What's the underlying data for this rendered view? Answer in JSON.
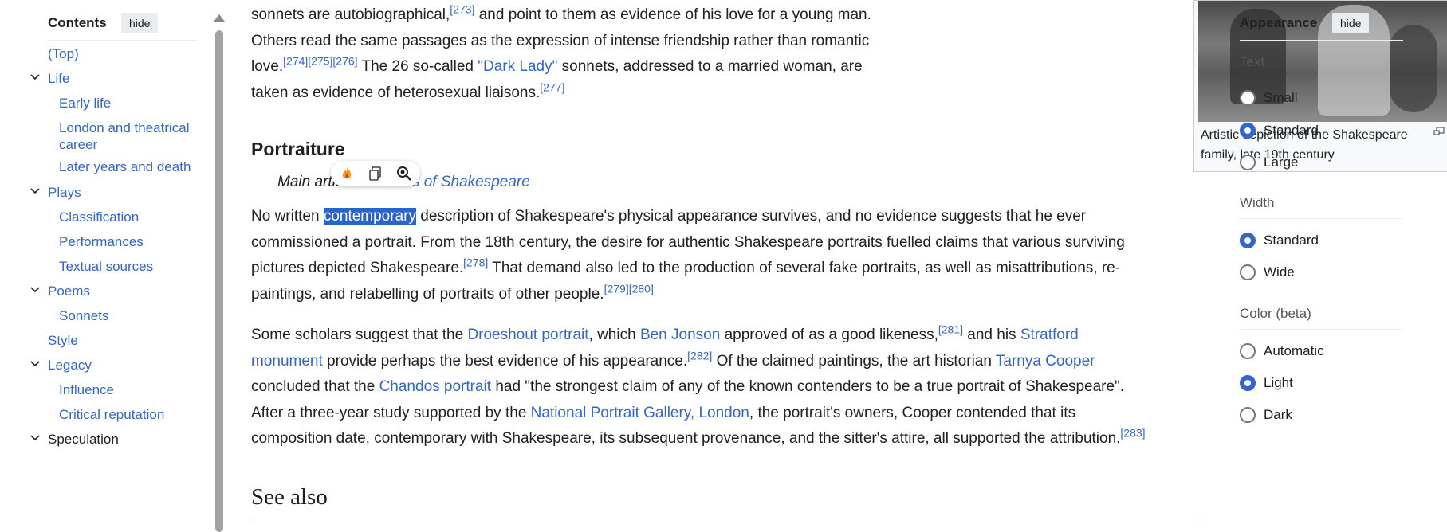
{
  "toc": {
    "title": "Contents",
    "hide_label": "hide",
    "items": [
      {
        "label": "(Top)"
      },
      {
        "label": "Life"
      },
      {
        "label": "Early life"
      },
      {
        "label": "London and theatrical career"
      },
      {
        "label": "Later years and death"
      },
      {
        "label": "Plays"
      },
      {
        "label": "Classification"
      },
      {
        "label": "Performances"
      },
      {
        "label": "Textual sources"
      },
      {
        "label": "Poems"
      },
      {
        "label": "Sonnets"
      },
      {
        "label": "Style"
      },
      {
        "label": "Legacy"
      },
      {
        "label": "Influence"
      },
      {
        "label": "Critical reputation"
      },
      {
        "label": "Speculation"
      }
    ]
  },
  "article": {
    "intro": {
      "l1a": "sonnets are autobiographical,",
      "r273": "[273]",
      "l1b": " and point to them as evidence of his love for a young man.",
      "l2": "Others read the same passages as the expression of intense friendship rather than romantic",
      "l3a": "love.",
      "r274": "[274]",
      "r275": "[275]",
      "r276": "[276]",
      "l3b": " The 26 so-called ",
      "dark_lady": "\"Dark Lady\"",
      "l3c": " sonnets, addressed to a married woman, are",
      "l4": "taken as evidence of heterosexual liaisons.",
      "r277": "[277]"
    },
    "heading": "Portraiture",
    "hatnote_prefix": "Main article: ",
    "hatnote_link": "Portraits of Shakespeare",
    "p1": {
      "a": "No written ",
      "highlight": "contemporary",
      "b": " description of Shakespeare's physical appearance survives, and no evidence suggests that he ever",
      "c": "commissioned a portrait. From the 18th century, the desire for authentic Shakespeare portraits fuelled claims that various surviving",
      "d": "pictures depicted Shakespeare.",
      "r278": "[278]",
      "e": " That demand also led to the production of several fake portraits, as well as misattributions, re-",
      "f": "paintings, and relabelling of portraits of other people.",
      "r279": "[279]",
      "r280": "[280]"
    },
    "p2": {
      "a": "Some scholars suggest that the ",
      "droeshout": "Droeshout portrait",
      "b": ", which ",
      "jonson": "Ben Jonson",
      "c": " approved of as a good likeness,",
      "r281": "[281]",
      "d": " and his ",
      "stratford1": "Stratford",
      "stratford2": "monument",
      "e": " provide perhaps the best evidence of his appearance.",
      "r282": "[282]",
      "f": " Of the claimed paintings, the art historian ",
      "cooper": "Tarnya Cooper",
      "g": "concluded that the ",
      "chandos": "Chandos portrait",
      "h": " had \"the strongest claim of any of the known contenders to be a true portrait of Shakespeare\".",
      "i": "After a three-year study supported by the ",
      "npg": "National Portrait Gallery, London",
      "j": ", the portrait's owners, Cooper contended that its",
      "k": "composition date, contemporary with Shakespeare, its subsequent provenance, and the sitter's attire, all supported the attribution.",
      "r283": "[283]"
    },
    "figure_caption": "Artistic depiction of the Shakespeare family, late 19th century",
    "see_also": "See also"
  },
  "appearance": {
    "title": "Appearance",
    "hide_label": "hide",
    "text_label": "Text",
    "text_options": [
      "Small",
      "Standard",
      "Large"
    ],
    "text_selected": "Standard",
    "width_label": "Width",
    "width_options": [
      "Standard",
      "Wide"
    ],
    "width_selected": "Standard",
    "color_label": "Color (beta)",
    "color_options": [
      "Automatic",
      "Light",
      "Dark"
    ],
    "color_selected": "Light"
  },
  "colors": {
    "link": "#3366cc",
    "accent": "#3366cc",
    "selection": "#2a63c9"
  },
  "icons": {
    "toolbar": [
      "flame-icon",
      "copy-icon",
      "magnifier-icon"
    ],
    "enlarge": "enlarge-icon",
    "chevron": "chevron-down-icon"
  }
}
